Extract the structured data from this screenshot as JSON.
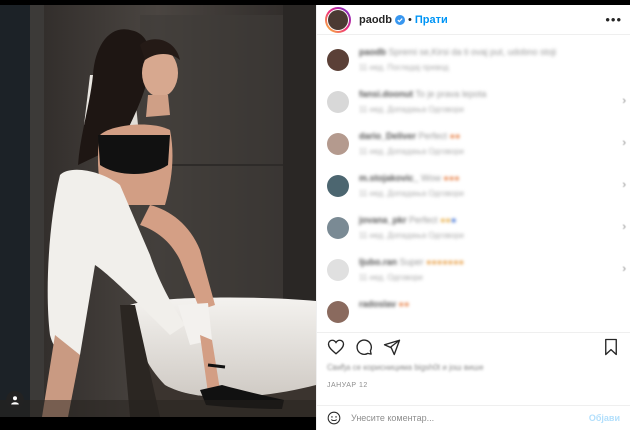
{
  "post": {
    "username": "paodb",
    "follow_label": "Прати",
    "separator": "•",
    "more_label": "•••",
    "date": "ЈАНУАР 12",
    "comment_placeholder": "Унесите коментар...",
    "post_label": "Објави"
  },
  "comments": [
    {
      "user": "paodb",
      "text": "Spremi se,Kirsi da ti ovaj put, udobno stoji",
      "meta": "11 нед.   Погледај превод"
    },
    {
      "user": "fansi.doonut",
      "text": "To je prava lepota",
      "meta": "11 нед.   Допадања   Одговори"
    },
    {
      "user": "dario_Deliver",
      "text": "Perfect",
      "meta": "11 нед.   Допадања   Одговори"
    },
    {
      "user": "m.stojakovic_",
      "text": "Wow",
      "meta": "11 нед.   Допадања   Одговори"
    },
    {
      "user": "jovana_pkr",
      "text": "Perfect",
      "meta": "11 нед.   Допадања   Одговори"
    },
    {
      "user": "ljubo.ran",
      "text": "Super",
      "meta": "11 нед.   Одговори"
    },
    {
      "user": "radoslav",
      "text": "",
      "meta": ""
    }
  ],
  "likes_text": "Свиђа се корисницима bigsh0t и још више",
  "colors": {
    "accent": "#0095f6",
    "post_disabled": "#b2dffc",
    "verified": "#3897f0"
  },
  "icons": [
    "verified-icon",
    "heart-icon",
    "comment-icon",
    "share-icon",
    "bookmark-icon",
    "emoji-icon",
    "user-tag-icon",
    "chevron-right-icon"
  ]
}
